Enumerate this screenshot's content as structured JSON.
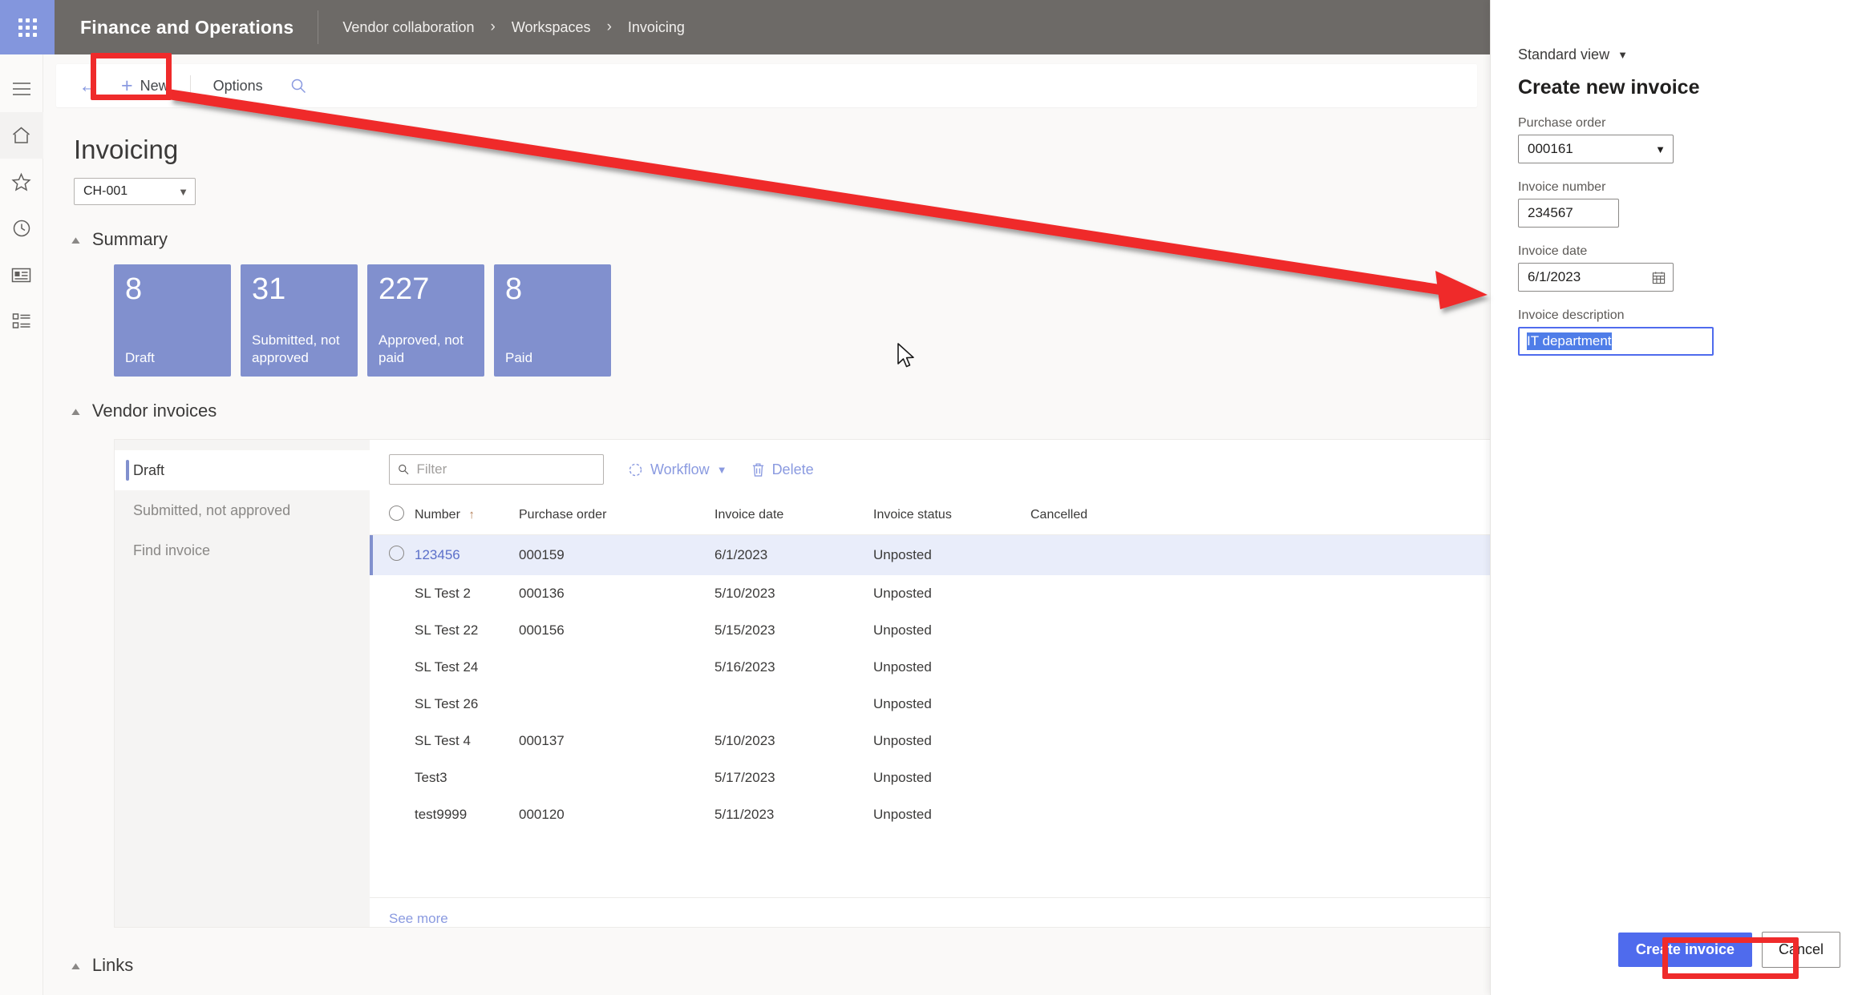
{
  "topbar": {
    "app_title": "Finance and Operations",
    "waffle_icon": "app-launcher-icon",
    "help_icon": "question-mark-icon",
    "breadcrumb": [
      "Vendor collaboration",
      "Workspaces",
      "Invoicing"
    ],
    "breadcrumb_separator": "›",
    "bg_color": "#6d6a67",
    "waffle_color": "#8396dd"
  },
  "rail": {
    "items": [
      {
        "icon": "hamburger-menu-icon",
        "active": false
      },
      {
        "icon": "home-icon",
        "active": true
      },
      {
        "icon": "star-favorites-icon",
        "active": false
      },
      {
        "icon": "clock-recent-icon",
        "active": false
      },
      {
        "icon": "workspaces-icon",
        "active": false
      },
      {
        "icon": "modules-list-icon",
        "active": false
      }
    ]
  },
  "command_bar": {
    "back_icon": "back-arrow-icon",
    "new_label": "New",
    "new_icon": "plus-icon",
    "options_label": "Options",
    "search_icon": "search-icon"
  },
  "page": {
    "title": "Invoicing",
    "legal_entity": "CH-001",
    "chevron": "⌄"
  },
  "summary": {
    "section_label": "Summary",
    "caret_icon": "chevron-up-icon",
    "tile_color": "#8190ce",
    "tiles": [
      {
        "value": "8",
        "label": "Draft"
      },
      {
        "value": "31",
        "label": "Submitted, not approved"
      },
      {
        "value": "227",
        "label": "Approved, not paid"
      },
      {
        "value": "8",
        "label": "Paid"
      }
    ]
  },
  "vendor_invoices": {
    "section_label": "Vendor invoices",
    "caret_icon": "chevron-up-icon",
    "tabs": [
      {
        "label": "Draft",
        "active": true
      },
      {
        "label": "Submitted, not approved",
        "active": false
      },
      {
        "label": "Find invoice",
        "active": false
      }
    ],
    "filter_placeholder": "Filter",
    "filter_value": "",
    "filter_icon": "search-icon",
    "workflow_label": "Workflow",
    "workflow_icon": "workflow-circle-icon",
    "delete_label": "Delete",
    "delete_icon": "trash-icon",
    "see_more_label": "See more",
    "columns": [
      "",
      "Number",
      "Purchase order",
      "Invoice date",
      "Invoice status",
      "Cancelled"
    ],
    "sort_column": "Number",
    "sort_direction_icon": "sort-ascending-arrow",
    "rows": [
      {
        "number": "123456",
        "purchase_order": "000159",
        "invoice_date": "6/1/2023",
        "invoice_status": "Unposted",
        "cancelled": "",
        "selected": true
      },
      {
        "number": "SL Test 2",
        "purchase_order": "000136",
        "invoice_date": "5/10/2023",
        "invoice_status": "Unposted",
        "cancelled": "",
        "selected": false
      },
      {
        "number": "SL Test 22",
        "purchase_order": "000156",
        "invoice_date": "5/15/2023",
        "invoice_status": "Unposted",
        "cancelled": "",
        "selected": false
      },
      {
        "number": "SL Test 24",
        "purchase_order": "",
        "invoice_date": "5/16/2023",
        "invoice_status": "Unposted",
        "cancelled": "",
        "selected": false
      },
      {
        "number": "SL Test 26",
        "purchase_order": "",
        "invoice_date": "",
        "invoice_status": "Unposted",
        "cancelled": "",
        "selected": false
      },
      {
        "number": "SL Test 4",
        "purchase_order": "000137",
        "invoice_date": "5/10/2023",
        "invoice_status": "Unposted",
        "cancelled": "",
        "selected": false
      },
      {
        "number": "Test3",
        "purchase_order": "",
        "invoice_date": "5/17/2023",
        "invoice_status": "Unposted",
        "cancelled": "",
        "selected": false
      },
      {
        "number": "test9999",
        "purchase_order": "000120",
        "invoice_date": "5/11/2023",
        "invoice_status": "Unposted",
        "cancelled": "",
        "selected": false
      }
    ]
  },
  "links": {
    "section_label": "Links",
    "caret_icon": "chevron-up-icon"
  },
  "panel": {
    "view_label": "Standard view",
    "view_chevron_icon": "chevron-down-icon",
    "title": "Create new invoice",
    "fields": {
      "purchase_order": {
        "label": "Purchase order",
        "value": "000161",
        "chevron_icon": "chevron-down-icon"
      },
      "invoice_number": {
        "label": "Invoice number",
        "value": "234567"
      },
      "invoice_date": {
        "label": "Invoice date",
        "value": "6/1/2023",
        "calendar_icon": "calendar-icon"
      },
      "invoice_description": {
        "label": "Invoice description",
        "value": "IT department",
        "selected": true
      }
    },
    "create_label": "Create invoice",
    "cancel_label": "Cancel",
    "primary_color": "#4f6bed",
    "selection_color": "#4f7de8"
  },
  "annotations": {
    "highlight_color": "#ef2b2b",
    "boxes": [
      "new-button-highlight",
      "create-invoice-button-highlight"
    ],
    "arrow": "new-button-to-panel-arrow"
  }
}
